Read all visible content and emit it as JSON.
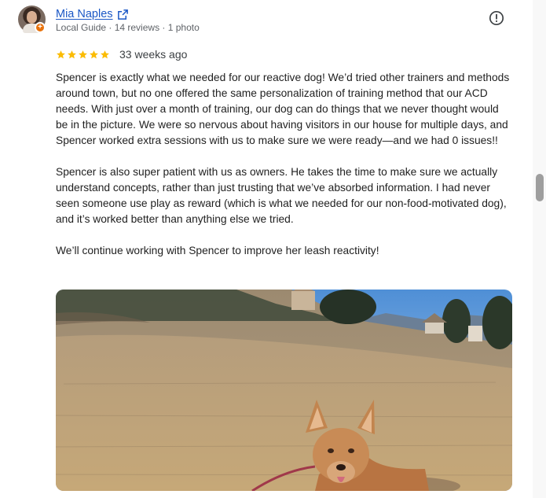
{
  "review": {
    "author": {
      "name": "Mia Naples",
      "meta": "Local Guide · 14 reviews · 1 photo",
      "badge": "+"
    },
    "rating": 5,
    "stars_color": "#fbbc04",
    "date": "33 weeks ago",
    "paragraphs": [
      "Spencer is exactly what we needed for our reactive dog! We’d tried other trainers and methods around town, but no one offered the same personalization of training method that our ACD needs. With just over a month of training, our dog can do things that we never thought would be in the picture. We were so nervous about having visitors in our house for multiple days, and Spencer worked extra sessions with us to make sure we were ready—and we had 0 issues!!",
      "Spencer is also super patient with us as owners. He takes the time to make sure we actually understand concepts, rather than just trusting that we’ve absorbed information. I had never seen someone use play as reward (which is what we needed for our non-food-motivated dog), and it’s worked better than anything else we tried.",
      "We’ll continue working with Spencer to improve her leash reactivity!"
    ],
    "icons": {
      "external_link": "external-link-icon",
      "report": "report-icon"
    }
  },
  "colors": {
    "link": "#1a57c5",
    "badge": "#e8710a",
    "scroll_thumb": "#9e9e9e"
  }
}
